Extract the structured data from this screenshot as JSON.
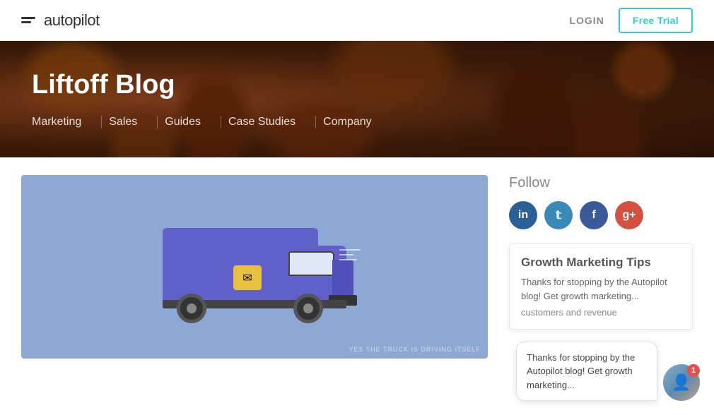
{
  "header": {
    "logo_text": "autopilot",
    "login_label": "LOGIN",
    "free_trial_label": "Free Trial"
  },
  "hero": {
    "title": "Liftoff Blog",
    "nav_items": [
      "Marketing",
      "Sales",
      "Guides",
      "Case Studies",
      "Company"
    ]
  },
  "sidebar": {
    "follow_title": "Follow",
    "social": [
      {
        "name": "LinkedIn",
        "icon": "in"
      },
      {
        "name": "Twitter",
        "icon": "t"
      },
      {
        "name": "Facebook",
        "icon": "f"
      },
      {
        "name": "Google+",
        "icon": "g+"
      }
    ],
    "newsletter": {
      "title": "Growth Marketing Tips",
      "text": "Thanks for stopping by the Autopilot blog! Get growth marketing...",
      "sub": "customers and revenue"
    }
  },
  "truck": {
    "caption": "YES THE TRUCK IS DRIVING ITSELF"
  },
  "chat": {
    "message": "Thanks for stopping by the Autopilot blog! Get growth marketing...",
    "badge": "1"
  }
}
